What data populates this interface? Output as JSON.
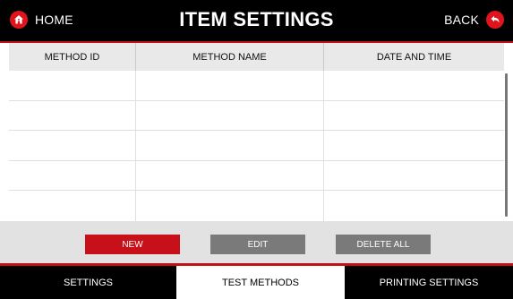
{
  "header": {
    "home_label": "HOME",
    "title": "ITEM SETTINGS",
    "back_label": "BACK"
  },
  "table": {
    "columns": [
      "METHOD ID",
      "METHOD NAME",
      "DATE AND TIME"
    ],
    "rows": [
      [
        "",
        "",
        ""
      ],
      [
        "",
        "",
        ""
      ],
      [
        "",
        "",
        ""
      ],
      [
        "",
        "",
        ""
      ],
      [
        "",
        "",
        ""
      ]
    ]
  },
  "actions": {
    "new_label": "NEW",
    "edit_label": "EDIT",
    "delete_all_label": "DELETE ALL"
  },
  "tabs": [
    {
      "label": "SETTINGS",
      "active": false
    },
    {
      "label": "TEST METHODS",
      "active": true
    },
    {
      "label": "PRINTING SETTINGS",
      "active": false
    }
  ],
  "colors": {
    "accent": "#e0141c",
    "bar": "#000000",
    "button_gray": "#7a7a7a",
    "header_bg": "#e9e9e9"
  },
  "icons": {
    "home": "home-icon",
    "back": "back-arrow-icon"
  }
}
